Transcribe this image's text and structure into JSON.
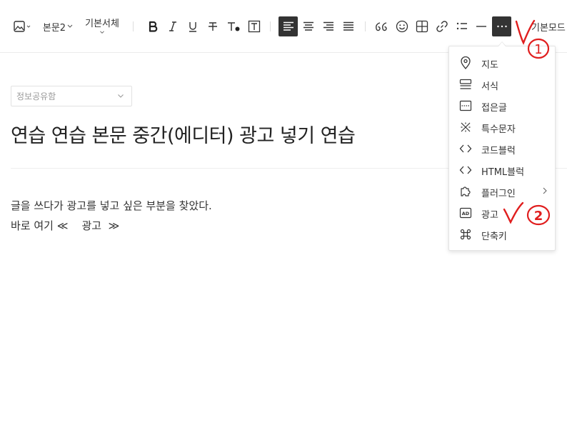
{
  "toolbar": {
    "paragraph_style": "본문2",
    "font_family": "기본서체",
    "mode_label": "기본모드"
  },
  "category": {
    "value": "정보공유함"
  },
  "post": {
    "title": "연습 연습 본문 중간(에디터) 광고 넣기 연습",
    "lines": [
      "글을 쓰다가 광고를 넣고 싶은 부분을 찾았다.",
      "바로 여기 ≪    광고  ≫"
    ]
  },
  "more_menu": {
    "items": [
      {
        "label": "지도",
        "icon": "map-pin-icon"
      },
      {
        "label": "서식",
        "icon": "template-icon"
      },
      {
        "label": "접은글",
        "icon": "fold-icon"
      },
      {
        "label": "특수문자",
        "icon": "special-char-icon"
      },
      {
        "label": "코드블럭",
        "icon": "code-icon"
      },
      {
        "label": "HTML블럭",
        "icon": "html-icon"
      },
      {
        "label": "플러그인",
        "icon": "plugin-icon"
      },
      {
        "label": "광고",
        "icon": "ad-icon"
      },
      {
        "label": "단축키",
        "icon": "command-icon"
      }
    ]
  },
  "annotations": {
    "mark1": "1",
    "mark2": "2",
    "color": "#e01e1e"
  }
}
